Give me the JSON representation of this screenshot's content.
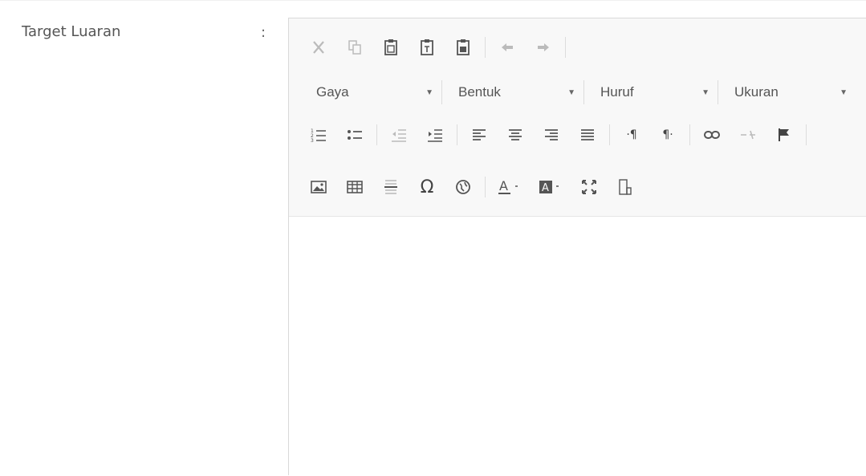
{
  "field": {
    "label": "Target Luaran",
    "separator": ":"
  },
  "toolbar": {
    "row1": [
      {
        "name": "cut-icon",
        "disabled": true
      },
      {
        "name": "copy-icon",
        "disabled": true
      },
      {
        "name": "paste-icon",
        "disabled": false
      },
      {
        "name": "paste-text-icon",
        "disabled": false
      },
      {
        "name": "paste-word-icon",
        "disabled": false
      },
      {
        "name": "undo-icon",
        "disabled": true
      },
      {
        "name": "redo-icon",
        "disabled": true
      }
    ],
    "combos": [
      {
        "label": "Gaya"
      },
      {
        "label": "Bentuk"
      },
      {
        "label": "Huruf"
      },
      {
        "label": "Ukuran"
      }
    ],
    "row3": [
      "numbered-list-icon",
      "bulleted-list-icon",
      "decrease-indent-icon",
      "increase-indent-icon",
      "align-left-icon",
      "align-center-icon",
      "align-right-icon",
      "justify-icon",
      "ltr-icon",
      "rtl-icon",
      "link-icon",
      "unlink-icon",
      "anchor-icon"
    ],
    "row4": [
      "image-icon",
      "table-icon",
      "horizontal-line-icon",
      "special-char-icon",
      "iframe-icon",
      "text-color-icon",
      "background-color-icon",
      "maximize-icon",
      "show-blocks-icon"
    ]
  },
  "colors": {
    "toolbar_bg": "#f8f8f8",
    "border": "#d9d9d9",
    "icon": "#444444",
    "icon_disabled": "#bbbbbb"
  }
}
